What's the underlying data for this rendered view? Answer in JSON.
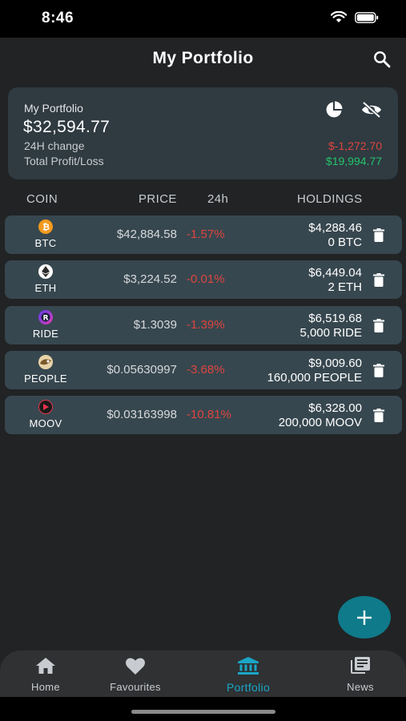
{
  "status_bar": {
    "time": "8:46"
  },
  "header": {
    "title": "My Portfolio"
  },
  "summary": {
    "label": "My Portfolio",
    "total": "$32,594.77",
    "change_label": "24H change",
    "change_value": "$-1,272.70",
    "profit_label": "Total Profit/Loss",
    "profit_value": "$19,994.77",
    "colors": {
      "negative": "#e0443e",
      "positive": "#23c46a"
    }
  },
  "columns": {
    "coin": "COIN",
    "price": "PRICE",
    "change": "24h",
    "holdings": "HOLDINGS"
  },
  "coins": [
    {
      "symbol": "BTC",
      "price": "$42,884.58",
      "change": "-1.57%",
      "value": "$4,288.46",
      "amount": "0 BTC",
      "icon": "bitcoin-icon"
    },
    {
      "symbol": "ETH",
      "price": "$3,224.52",
      "change": "-0.01%",
      "value": "$6,449.04",
      "amount": "2 ETH",
      "icon": "ethereum-icon"
    },
    {
      "symbol": "RIDE",
      "price": "$1.3039",
      "change": "-1.39%",
      "value": "$6,519.68",
      "amount": "5,000 RIDE",
      "icon": "ride-icon"
    },
    {
      "symbol": "PEOPLE",
      "price": "$0.05630997",
      "change": "-3.68%",
      "value": "$9,009.60",
      "amount": "160,000 PEOPLE",
      "icon": "people-icon"
    },
    {
      "symbol": "MOOV",
      "price": "$0.03163998",
      "change": "-10.81%",
      "value": "$6,328.00",
      "amount": "200,000 MOOV",
      "icon": "moov-icon"
    }
  ],
  "nav": {
    "items": [
      {
        "label": "Home",
        "icon": "home-icon"
      },
      {
        "label": "Favourites",
        "icon": "heart-icon"
      },
      {
        "label": "Portfolio",
        "icon": "bank-icon",
        "active": true
      },
      {
        "label": "News",
        "icon": "news-icon"
      }
    ],
    "active_color": "#1aa6c6"
  },
  "colors": {
    "background": "#212325",
    "card": "#2f3a41",
    "row": "#37474f",
    "fab": "#0f7a8a"
  }
}
